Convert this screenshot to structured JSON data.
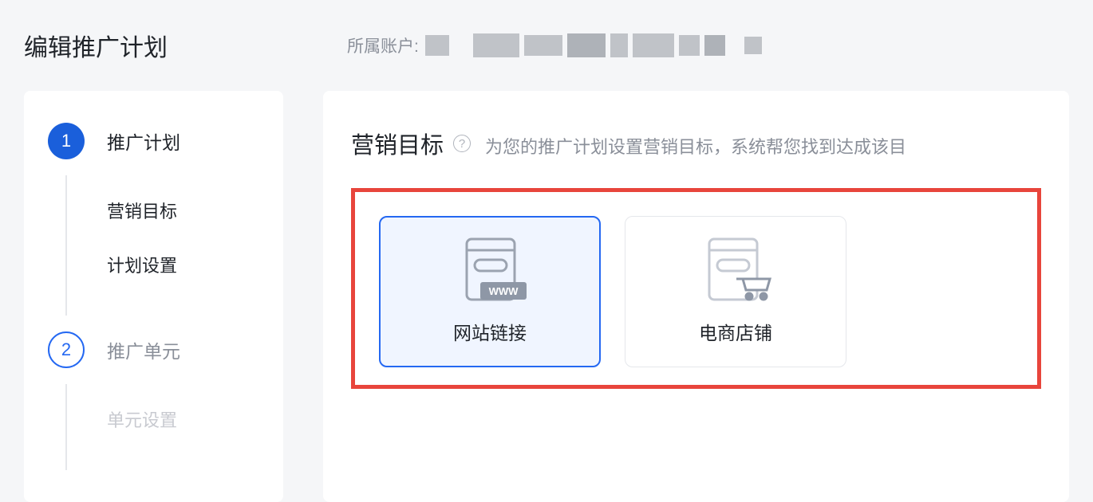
{
  "header": {
    "title": "编辑推广计划",
    "account_label": "所属账户:"
  },
  "sidebar": {
    "step1": {
      "number": "1",
      "label": "推广计划",
      "subs": [
        "营销目标",
        "计划设置"
      ]
    },
    "step2": {
      "number": "2",
      "label": "推广单元",
      "subs": [
        "单元设置"
      ]
    }
  },
  "content": {
    "section_title": "营销目标",
    "section_desc": "为您的推广计划设置营销目标，系统帮您找到达成该目",
    "options": {
      "website": "网站链接",
      "ecommerce": "电商店铺"
    }
  }
}
